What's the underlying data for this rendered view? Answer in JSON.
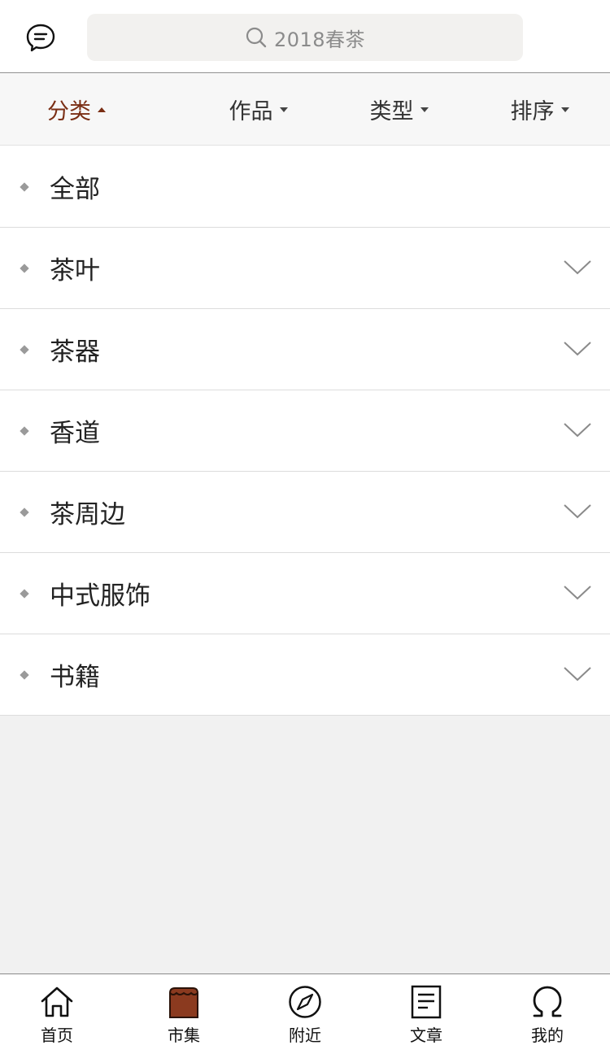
{
  "header": {
    "message_icon": "chat-bubble-icon",
    "search_icon": "search-icon",
    "search_placeholder": "2018春茶"
  },
  "filters": [
    {
      "label": "分类",
      "active": true
    },
    {
      "label": "作品",
      "active": false
    },
    {
      "label": "类型",
      "active": false
    },
    {
      "label": "排序",
      "active": false
    }
  ],
  "colors": {
    "accent": "#7a2e14",
    "market_icon": "#8b3a1f",
    "search_bg": "#f2f1ef",
    "filter_bg": "#f7f7f7",
    "empty_bg": "#f1f1f1"
  },
  "categories": [
    {
      "label": "全部",
      "expandable": false
    },
    {
      "label": "茶叶",
      "expandable": true
    },
    {
      "label": "茶器",
      "expandable": true
    },
    {
      "label": "香道",
      "expandable": true
    },
    {
      "label": "茶周边",
      "expandable": true
    },
    {
      "label": "中式服饰",
      "expandable": true
    },
    {
      "label": "书籍",
      "expandable": true
    }
  ],
  "tabbar": {
    "items": [
      {
        "label": "首页",
        "icon": "home-icon"
      },
      {
        "label": "市集",
        "icon": "market-icon",
        "active": true
      },
      {
        "label": "附近",
        "icon": "compass-icon"
      },
      {
        "label": "文章",
        "icon": "article-icon"
      },
      {
        "label": "我的",
        "icon": "profile-icon"
      }
    ]
  }
}
